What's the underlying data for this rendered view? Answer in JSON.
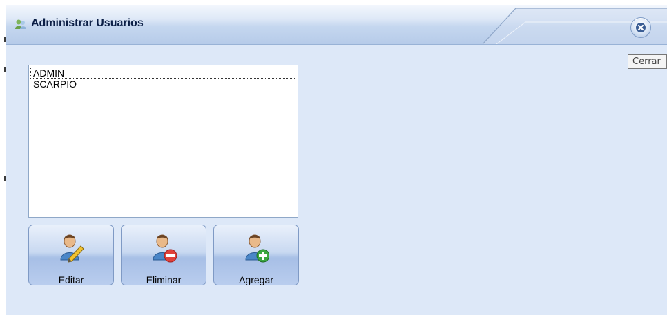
{
  "window": {
    "title": "Administrar Usuarios",
    "title_icon": "users-admin-icon",
    "close_icon": "close-icon",
    "tooltip": "Cerrar"
  },
  "users_list": {
    "items": [
      "ADMIN",
      "SCARPIO"
    ],
    "selected": "ADMIN"
  },
  "actions": {
    "edit_label": "Editar",
    "delete_label": "Eliminar",
    "add_label": "Agregar",
    "edit_icon": "edit-user-icon",
    "delete_icon": "remove-user-icon",
    "add_icon": "add-user-icon"
  },
  "colors": {
    "window_bg": "#dde8f8",
    "title_text": "#0b1f46",
    "delete_accent": "#e0403a",
    "add_accent": "#3aa640"
  }
}
